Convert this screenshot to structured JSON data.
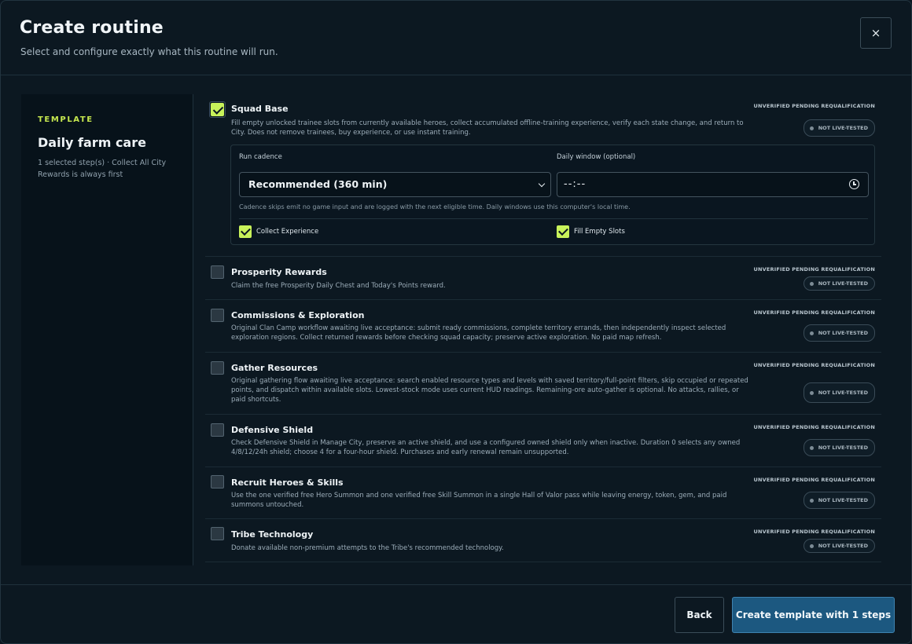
{
  "header": {
    "title": "Create routine",
    "subtitle": "Select and configure exactly what this routine will run.",
    "close_label": "×"
  },
  "sidebar": {
    "label": "TEMPLATE",
    "name": "Daily farm care",
    "description": "1 selected step(s) · Collect All City Rewards is always first"
  },
  "steps": [
    {
      "title": "Squad Base",
      "checked": true,
      "description": "Fill empty unlocked trainee slots from currently available heroes, collect accumulated offline-training experience, verify each state change, and return to City. Does not remove trainees, buy experience, or use instant training.",
      "status": "UNVERIFIED PENDING REQUALIFICATION",
      "badge": "NOT LIVE-TESTED"
    },
    {
      "title": "Prosperity Rewards",
      "checked": false,
      "description": "Claim the free Prosperity Daily Chest and Today's Points reward.",
      "status": "UNVERIFIED PENDING REQUALIFICATION",
      "badge": "NOT LIVE-TESTED"
    },
    {
      "title": "Commissions & Exploration",
      "checked": false,
      "description": "Original Clan Camp workflow awaiting live acceptance: submit ready commissions, complete territory errands, then independently inspect selected exploration regions. Collect returned rewards before checking squad capacity; preserve active exploration. No paid map refresh.",
      "status": "UNVERIFIED PENDING REQUALIFICATION",
      "badge": "NOT LIVE-TESTED"
    },
    {
      "title": "Gather Resources",
      "checked": false,
      "description": "Original gathering flow awaiting live acceptance: search enabled resource types and levels with saved territory/full-point filters, skip occupied or repeated points, and dispatch within available slots. Lowest-stock mode uses current HUD readings. Remaining-ore auto-gather is optional. No attacks, rallies, or paid shortcuts.",
      "status": "UNVERIFIED PENDING REQUALIFICATION",
      "badge": "NOT LIVE-TESTED"
    },
    {
      "title": "Defensive Shield",
      "checked": false,
      "description": "Check Defensive Shield in Manage City, preserve an active shield, and use a configured owned shield only when inactive. Duration 0 selects any owned 4/8/12/24h shield; choose 4 for a four-hour shield. Purchases and early renewal remain unsupported.",
      "status": "UNVERIFIED PENDING REQUALIFICATION",
      "badge": "NOT LIVE-TESTED"
    },
    {
      "title": "Recruit Heroes & Skills",
      "checked": false,
      "description": "Use the one verified free Hero Summon and one verified free Skill Summon in a single Hall of Valor pass while leaving energy, token, gem, and paid summons untouched.",
      "status": "UNVERIFIED PENDING REQUALIFICATION",
      "badge": "NOT LIVE-TESTED"
    },
    {
      "title": "Tribe Technology",
      "checked": false,
      "description": "Donate available non-premium attempts to the Tribe's recommended technology.",
      "status": "UNVERIFIED PENDING REQUALIFICATION",
      "badge": "NOT LIVE-TESTED"
    }
  ],
  "config": {
    "cadence_label": "Run cadence",
    "cadence_value": "Recommended (360 min)",
    "window_label": "Daily window (optional)",
    "window_value": "--:--",
    "help": "Cadence skips emit no game input and are logged with the next eligible time. Daily windows use this computer's local time.",
    "option_1": "Collect Experience",
    "option_2": "Fill Empty Slots"
  },
  "footer": {
    "back_label": "Back",
    "create_label": "Create template with 1 steps"
  },
  "colors": {
    "accent": "#c8f25a",
    "primary_button": "#1c5880",
    "background": "#0c1821"
  }
}
